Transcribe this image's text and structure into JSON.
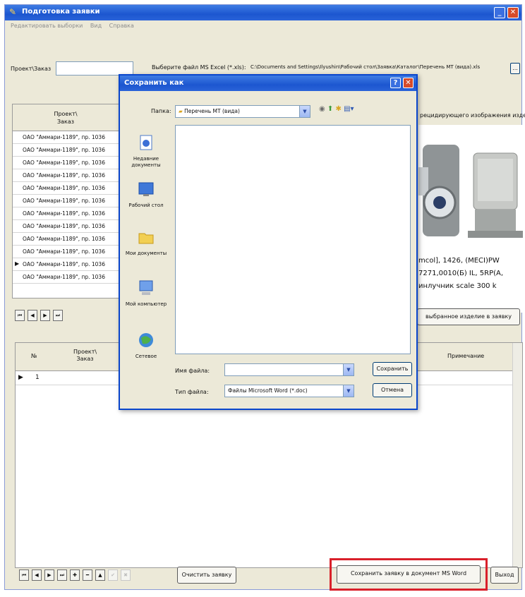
{
  "window": {
    "title": "Подготовка заявки",
    "menu": [
      "Редактировать выборки",
      "Вид",
      "Справка"
    ]
  },
  "form": {
    "order_label": "Проект\\Заказ",
    "order_value": "",
    "file_label": "Выберите файл MS Excel (*.xls):",
    "file_path": "C:\\Documents and Settings\\Ilyushin\\Рабочий стол\\Заявка\\Каталог\\Перечень МТ (вида).xls",
    "browse_label": "..."
  },
  "grid1": {
    "header_line1": "Проект\\",
    "header_line2": "Заказ",
    "rows": [
      "ОАО \"Аммари-1189\", пр. 1036",
      "ОАО \"Аммари-1189\", пр. 1036",
      "ОАО \"Аммари-1189\", пр. 1036",
      "ОАО \"Аммари-1189\", пр. 1036",
      "ОАО \"Аммари-1189\", пр. 1036",
      "ОАО \"Аммари-1189\", пр. 1036",
      "ОАО \"Аммари-1189\", пр. 1036",
      "ОАО \"Аммари-1189\", пр. 1036",
      "ОАО \"Аммари-1189\", пр. 1036",
      "ОАО \"Аммари-1189\", пр. 1036",
      "ОАО \"Аммари-1189\", пр. 1036",
      "ОАО \"Аммари-1189\", пр. 1036"
    ],
    "pointer": "▶",
    "nav": [
      "⏮",
      "◀",
      "▶",
      "⏭"
    ]
  },
  "right_panel": {
    "header": "рецидирующего изображения изделия",
    "caption": [
      "mcol], 1426, (MECI)PW",
      "7271,0010(Б) IL, 5RP(A,",
      "инлучник scale 300 k"
    ],
    "add_button": "выбранное изделие в заявку"
  },
  "grid2": {
    "col_num": "№",
    "col_order_line1": "Проект\\",
    "col_order_line2": "Заказ",
    "col_note": "Примечание",
    "row_pointer": "▶",
    "row_num": "1",
    "nav": [
      "⏮",
      "◀",
      "▶",
      "⏭",
      "✚",
      "━",
      "▲",
      "✔",
      "✖"
    ]
  },
  "bottom": {
    "clear_button": "Очистить заявку",
    "save_word_button": "Сохранить заявку в документ MS Word",
    "exit_button": "Выход"
  },
  "dialog": {
    "title": "Сохранить как",
    "help": "?",
    "close": "✕",
    "folder_label": "Папка:",
    "folder_value": "Перечень МТ (вида)",
    "places": [
      "Недавние документы",
      "Рабочий стол",
      "Мои документы",
      "Мой компьютер",
      "Сетевое"
    ],
    "filename_label": "Имя файла:",
    "filename_value": "",
    "filetype_label": "Тип файла:",
    "filetype_value": "Файлы Microsoft Word (*.doc)",
    "save_button": "Сохранить",
    "cancel_button": "Отмена"
  }
}
